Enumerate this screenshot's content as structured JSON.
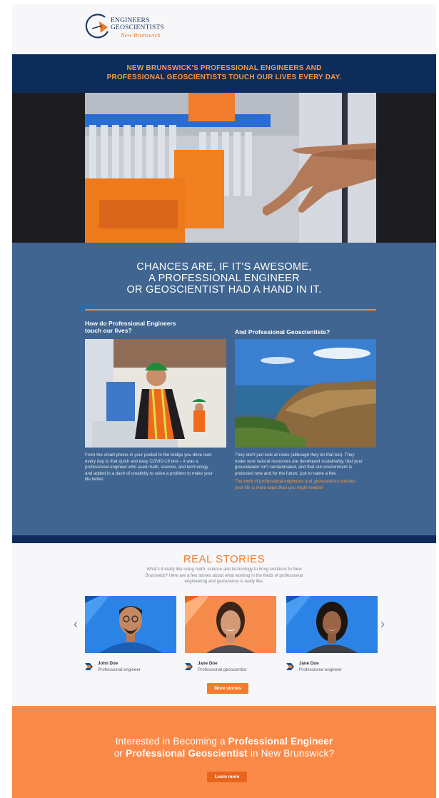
{
  "logo": {
    "line1": "ENGINEERS",
    "line2": "GEOSCIENTISTS",
    "line3": "New Brunswick"
  },
  "banner": {
    "line1": "NEW BRUNSWICK'S PROFESSIONAL ENGINEERS AND",
    "line2": "PROFESSIONAL GEOSCIENTISTS TOUCH OUR LIVES EVERY DAY."
  },
  "headline": {
    "line1": "CHANCES ARE, IF IT'S AWESOME,",
    "line2": "A PROFESSIONAL ENGINEER",
    "line3": "OR GEOSCIENTIST HAD A HAND IN IT."
  },
  "engineers": {
    "question_line1": "How do Professional Engineers",
    "question_line2": "touch our lives?",
    "text": "From the smart phone in your pocket to the bridge you drive over every day to that quick and easy COVID-19 test – it was a professional engineer who used math, science, and technology and added in a dash of creativity to solve a problem to make your life better."
  },
  "geoscientists": {
    "question": "And Professional Geoscientists?",
    "text": "They don't just look at rocks (although they do that too). They make sure natural resources are developed sustainably, that your groundwater isn't contaminated, and that our environment is protected now and for the future, just to name a few.",
    "highlight": "The work of professional engineers and geoscientists touches your life is more ways than you might realize!"
  },
  "stories": {
    "title": "REAL STORIES",
    "description": "What's it really like using math, science and technology to bring solutions to New Brunswick? Here are a few stories about what working in the fields of professional engineering and geoscience is really like.",
    "prev_arrow": "‹",
    "next_arrow": "›",
    "cards": [
      {
        "name": "John Doe",
        "role": "Professional engineer"
      },
      {
        "name": "Jane Doe",
        "role": "Professional geoscientist"
      },
      {
        "name": "Jane Doe",
        "role": "Professional engineer"
      }
    ],
    "more_button": "More stories"
  },
  "cta": {
    "line1_pre": "Interested in Becoming a ",
    "line1_bold": "Professional Engineer",
    "line2_pre": "or ",
    "line2_bold": "Professional Geoscientist",
    "line2_post": " in New Brunswick?",
    "button": "Learn more"
  },
  "colors": {
    "navy": "#0d2c5a",
    "blue": "#3f6590",
    "orange": "#f07c2c",
    "cta_orange": "#fb8a48"
  },
  "icons": [
    "logo-mark-icon",
    "chevron-left-icon",
    "chevron-right-icon",
    "story-flag-icon"
  ]
}
